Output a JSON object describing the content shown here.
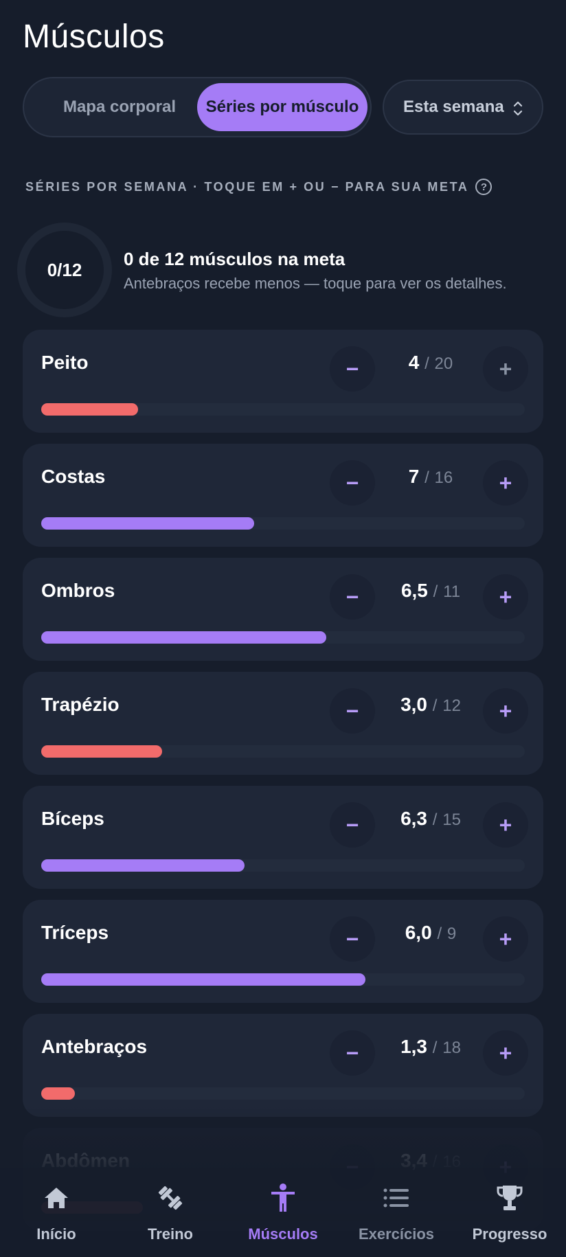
{
  "page": {
    "title": "Músculos"
  },
  "view_toggle": {
    "options": [
      "Mapa corporal",
      "Séries por músculo"
    ],
    "selected": "Séries por músculo"
  },
  "period": {
    "label": "Esta semana"
  },
  "section_label": "SÉRIES POR SEMANA · TOQUE EM + OU − PARA SUA META",
  "summary": {
    "ring_text": "0/12",
    "title": "0 de 12 músculos na meta",
    "subtitle": "Antebraços recebe menos — toque para ver os detalhes."
  },
  "colors": {
    "accent": "#a57cf6",
    "below_goal": "#f26b6b",
    "background": "#161d2b",
    "card": "#1f2738"
  },
  "muscles": [
    {
      "name": "Peito",
      "value": "4",
      "target": "20",
      "progress": 0.2,
      "status": "low"
    },
    {
      "name": "Costas",
      "value": "7",
      "target": "16",
      "progress": 0.44,
      "status": "ok"
    },
    {
      "name": "Ombros",
      "value": "6,5",
      "target": "11",
      "progress": 0.59,
      "status": "ok"
    },
    {
      "name": "Trapézio",
      "value": "3,0",
      "target": "12",
      "progress": 0.25,
      "status": "low"
    },
    {
      "name": "Bíceps",
      "value": "6,3",
      "target": "15",
      "progress": 0.42,
      "status": "ok"
    },
    {
      "name": "Tríceps",
      "value": "6,0",
      "target": "9",
      "progress": 0.67,
      "status": "ok"
    },
    {
      "name": "Antebraços",
      "value": "1,3",
      "target": "18",
      "progress": 0.07,
      "status": "low"
    },
    {
      "name": "Abdômen",
      "value": "3,4",
      "target": "16",
      "progress": 0.21,
      "status": "low"
    }
  ],
  "controls": {
    "minus": "−",
    "plus": "+",
    "separator": "/"
  },
  "nav": {
    "items": [
      {
        "label": "Início",
        "icon": "home-icon"
      },
      {
        "label": "Treino",
        "icon": "dumbbell-icon"
      },
      {
        "label": "Músculos",
        "icon": "body-icon"
      },
      {
        "label": "Exercícios",
        "icon": "list-icon"
      },
      {
        "label": "Progresso",
        "icon": "trophy-icon"
      }
    ],
    "active": "Músculos"
  }
}
